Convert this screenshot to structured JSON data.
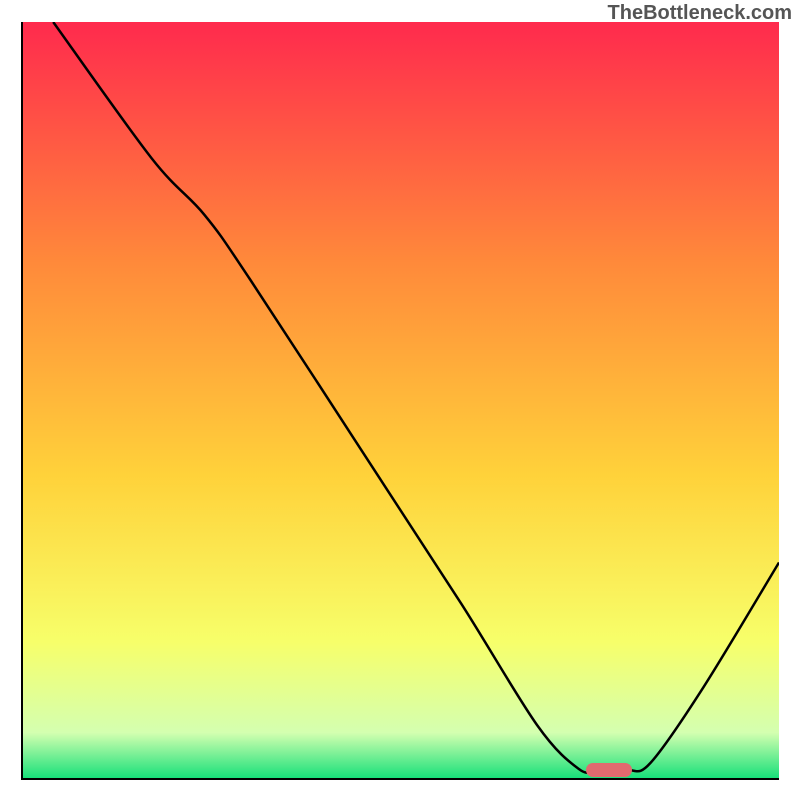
{
  "watermark": "TheBottleneck.com",
  "chart_data": {
    "type": "line",
    "title": "",
    "xlabel": "",
    "ylabel": "",
    "xlim": [
      0,
      100
    ],
    "ylim": [
      0,
      100
    ],
    "gradient_colors": {
      "top": "#ff2a4d",
      "upper_mid": "#ff8a3a",
      "mid": "#ffd23a",
      "lower_mid": "#f7ff6a",
      "near_bottom": "#d4ffb0",
      "bottom": "#18e07a"
    },
    "curve": [
      {
        "x": 4.0,
        "y": 100.0
      },
      {
        "x": 17.0,
        "y": 82.0
      },
      {
        "x": 24.0,
        "y": 74.5
      },
      {
        "x": 30.0,
        "y": 66.0
      },
      {
        "x": 45.0,
        "y": 43.0
      },
      {
        "x": 58.0,
        "y": 23.0
      },
      {
        "x": 68.0,
        "y": 7.0
      },
      {
        "x": 73.5,
        "y": 1.2
      },
      {
        "x": 76.0,
        "y": 1.0
      },
      {
        "x": 80.0,
        "y": 1.0
      },
      {
        "x": 83.0,
        "y": 2.0
      },
      {
        "x": 90.0,
        "y": 12.0
      },
      {
        "x": 100.0,
        "y": 28.5
      }
    ],
    "marker": {
      "x": 77.5,
      "y": 1.0,
      "color": "#e16a6f"
    }
  }
}
